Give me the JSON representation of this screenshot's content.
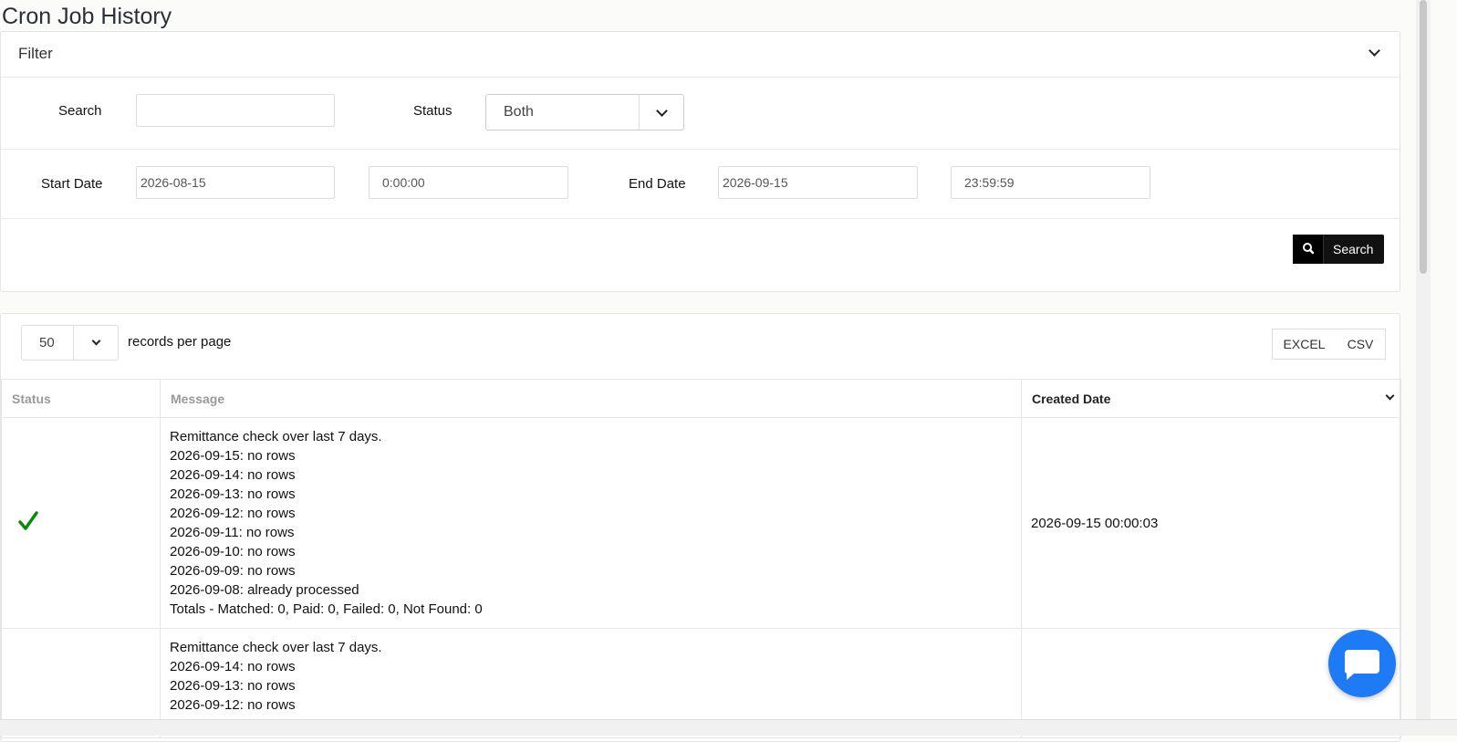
{
  "page": {
    "title": "Cron Job History"
  },
  "filter": {
    "title": "Filter",
    "search_label": "Search",
    "search_value": "",
    "status_label": "Status",
    "status_value": "Both",
    "start_date_label": "Start Date",
    "start_date": "2026-08-15",
    "start_time": "0:00:00",
    "end_date_label": "End Date",
    "end_date": "2026-09-15",
    "end_time": "23:59:59",
    "search_button": "Search"
  },
  "table_controls": {
    "page_size": "50",
    "page_size_label": "records per page",
    "excel_label": "EXCEL",
    "csv_label": "CSV"
  },
  "table": {
    "headers": [
      "Status",
      "Message",
      "Created Date"
    ],
    "rows": [
      {
        "status": "success",
        "message": [
          "Remittance check over last 7 days.",
          "2026-09-15: no rows",
          "2026-09-14: no rows",
          "2026-09-13: no rows",
          "2026-09-12: no rows",
          "2026-09-11: no rows",
          "2026-09-10: no rows",
          "2026-09-09: no rows",
          "2026-09-08: already processed",
          "Totals - Matched: 0, Paid: 0, Failed: 0, Not Found: 0"
        ],
        "created": "2026-09-15 00:00:03"
      },
      {
        "status": "",
        "message": [
          "Remittance check over last 7 days.",
          "2026-09-14: no rows",
          "2026-09-13: no rows",
          "2026-09-12: no rows"
        ],
        "created": ""
      }
    ]
  },
  "colors": {
    "accent": "#1d7bf5",
    "success": "#0a8a0a",
    "button_dark": "#111111"
  },
  "icons": {
    "chat": "chat-bubble-icon",
    "search": "search-icon",
    "check": "check-icon"
  }
}
